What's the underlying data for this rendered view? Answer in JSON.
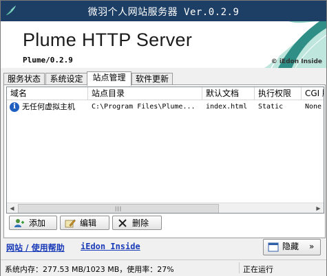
{
  "window": {
    "title": "微羽个人网站服务器 Ver.0.2.9"
  },
  "banner": {
    "product_name": "Plume HTTP Server",
    "version": "Plume/0.2.9",
    "copyright": "© iEdon Inside"
  },
  "tabs": [
    {
      "label": "服务状态",
      "active": false
    },
    {
      "label": "系统设定",
      "active": false
    },
    {
      "label": "站点管理",
      "active": true
    },
    {
      "label": "软件更新",
      "active": false
    }
  ],
  "site_table": {
    "columns": [
      "域名",
      "站点目录",
      "默认文档",
      "执行权限",
      "CGI 脚"
    ],
    "rows": [
      {
        "icon": "info-icon",
        "domain": "无任何虚拟主机",
        "directory": "C:\\Program Files\\Plume...",
        "default_doc": "index.html",
        "permission": "Static",
        "cgi": "None"
      }
    ]
  },
  "buttons": {
    "add": "添加",
    "edit": "编辑",
    "delete": "删除",
    "hide": "隐藏",
    "hide_arrow": "»"
  },
  "links": {
    "website_help": "网站 / 使用帮助",
    "brand": "iEdon Inside"
  },
  "status_bar": {
    "memory": "系统内存：277.53 MB/1023 MB，使用率：27%",
    "state": "正在运行"
  },
  "colors": {
    "titlebar": "#1d3f66",
    "link": "#1a3bb8"
  }
}
